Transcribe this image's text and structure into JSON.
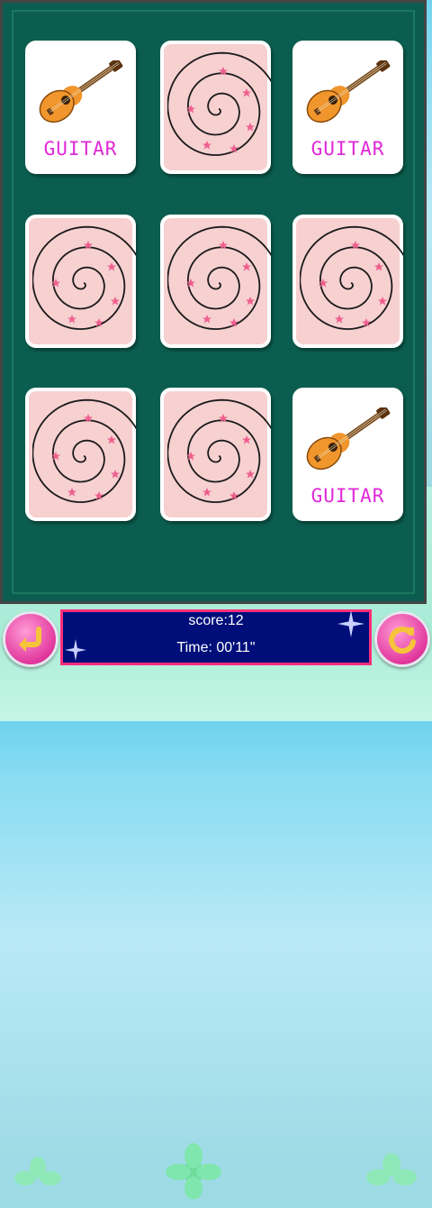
{
  "board": {
    "cards": [
      {
        "state": "face-up",
        "label": "GUITAR"
      },
      {
        "state": "face-down",
        "label": ""
      },
      {
        "state": "face-up",
        "label": "GUITAR"
      },
      {
        "state": "face-down",
        "label": ""
      },
      {
        "state": "face-down",
        "label": ""
      },
      {
        "state": "face-down",
        "label": ""
      },
      {
        "state": "face-down",
        "label": ""
      },
      {
        "state": "face-down",
        "label": ""
      },
      {
        "state": "face-up",
        "label": "GUITAR"
      }
    ]
  },
  "status": {
    "score": "score:12",
    "time": "Time: 00'11\""
  },
  "controls": {
    "back_icon": "return-arrow-icon",
    "restart_icon": "refresh-icon"
  },
  "colors": {
    "board": "#0b5e4f",
    "card_back": "#f7d0d0",
    "label": "#e028d8",
    "panel": "#000e7a",
    "panel_border": "#ff2d7d",
    "button": "#e2389e"
  }
}
